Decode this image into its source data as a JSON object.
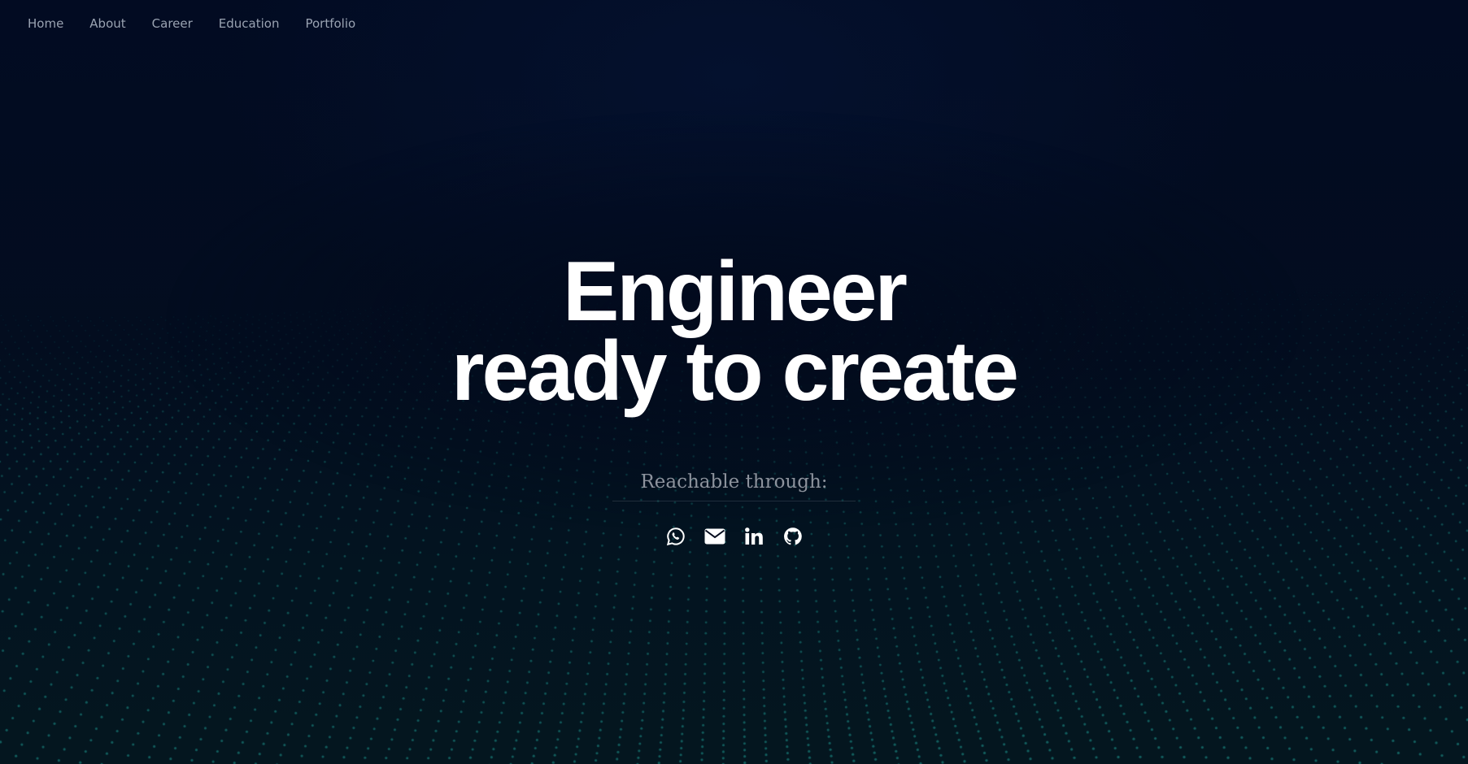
{
  "nav": {
    "items": [
      {
        "label": "Home"
      },
      {
        "label": "About"
      },
      {
        "label": "Career"
      },
      {
        "label": "Education"
      },
      {
        "label": "Portfolio"
      }
    ]
  },
  "hero": {
    "line1": "Engineer",
    "line2": "ready to create"
  },
  "contact": {
    "label": "Reachable through:",
    "icons": [
      "whatsapp-icon",
      "email-icon",
      "linkedin-icon",
      "github-icon"
    ]
  },
  "colors": {
    "background": "#020a1c",
    "dots": "#1c8a84",
    "headline": "#ffffff",
    "nav_text": "#9aa3b2"
  }
}
